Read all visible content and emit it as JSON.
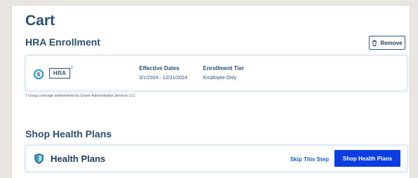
{
  "cart": {
    "title": "Cart"
  },
  "hra": {
    "section_title": "HRA Enrollment",
    "remove_label": "Remove",
    "logo_text": "HRA",
    "logo_superscript": "†",
    "effective_dates_label": "Effective Dates",
    "effective_dates_value": "3/1/2024 - 12/31/2024",
    "tier_label": "Enrollment Tier",
    "tier_value": "Employee Only",
    "footnote": "† Group coverage administered by Gravie Administrative Services LLC"
  },
  "shop": {
    "section_title": "Shop Health Plans",
    "card_label": "Health Plans",
    "skip_label": "Skip This Step",
    "shop_button_label": "Shop Health Plans"
  },
  "colors": {
    "primary_button": "#0a3ee3",
    "link": "#1a5bc8",
    "heading": "#2b4e70",
    "coin_icon": "#3aa3c9",
    "shield_icon": "#3aa3c9"
  },
  "icons": {
    "hra": "dollar-coin-icon",
    "remove": "trash-icon",
    "health_plans": "shield-icon"
  }
}
